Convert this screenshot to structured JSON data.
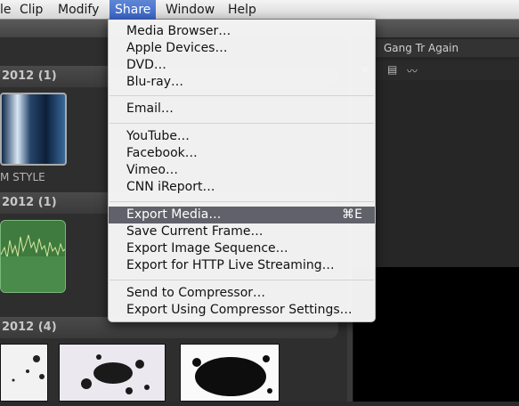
{
  "menubar": {
    "items": [
      {
        "label": "le"
      },
      {
        "label": "Clip"
      },
      {
        "label": "Modify"
      },
      {
        "label": "Share"
      },
      {
        "label": "Window"
      },
      {
        "label": "Help"
      }
    ]
  },
  "events": {
    "groups": [
      {
        "label": "2012  (1)"
      },
      {
        "label": "2012  (1)"
      },
      {
        "label": "2012  (4)"
      }
    ],
    "video_caption": "M STYLE"
  },
  "viewer": {
    "title": "Gang Tr Again"
  },
  "share_menu": {
    "items": [
      {
        "label": "Media Browser…"
      },
      {
        "label": "Apple Devices…"
      },
      {
        "label": "DVD…"
      },
      {
        "label": "Blu-ray…"
      },
      {
        "label": "Email…"
      },
      {
        "label": "YouTube…"
      },
      {
        "label": "Facebook…"
      },
      {
        "label": "Vimeo…"
      },
      {
        "label": "CNN iReport…"
      },
      {
        "label": "Export Media…",
        "shortcut": "⌘E"
      },
      {
        "label": "Save Current Frame…"
      },
      {
        "label": "Export Image Sequence…"
      },
      {
        "label": "Export for HTTP Live Streaming…"
      },
      {
        "label": "Send to Compressor…"
      },
      {
        "label": "Export Using Compressor Settings…"
      }
    ]
  },
  "colors": {
    "menu_highlight": "#61616a",
    "menubar_active": "#3862c4",
    "audio_waveform": "#3f7a3f"
  }
}
